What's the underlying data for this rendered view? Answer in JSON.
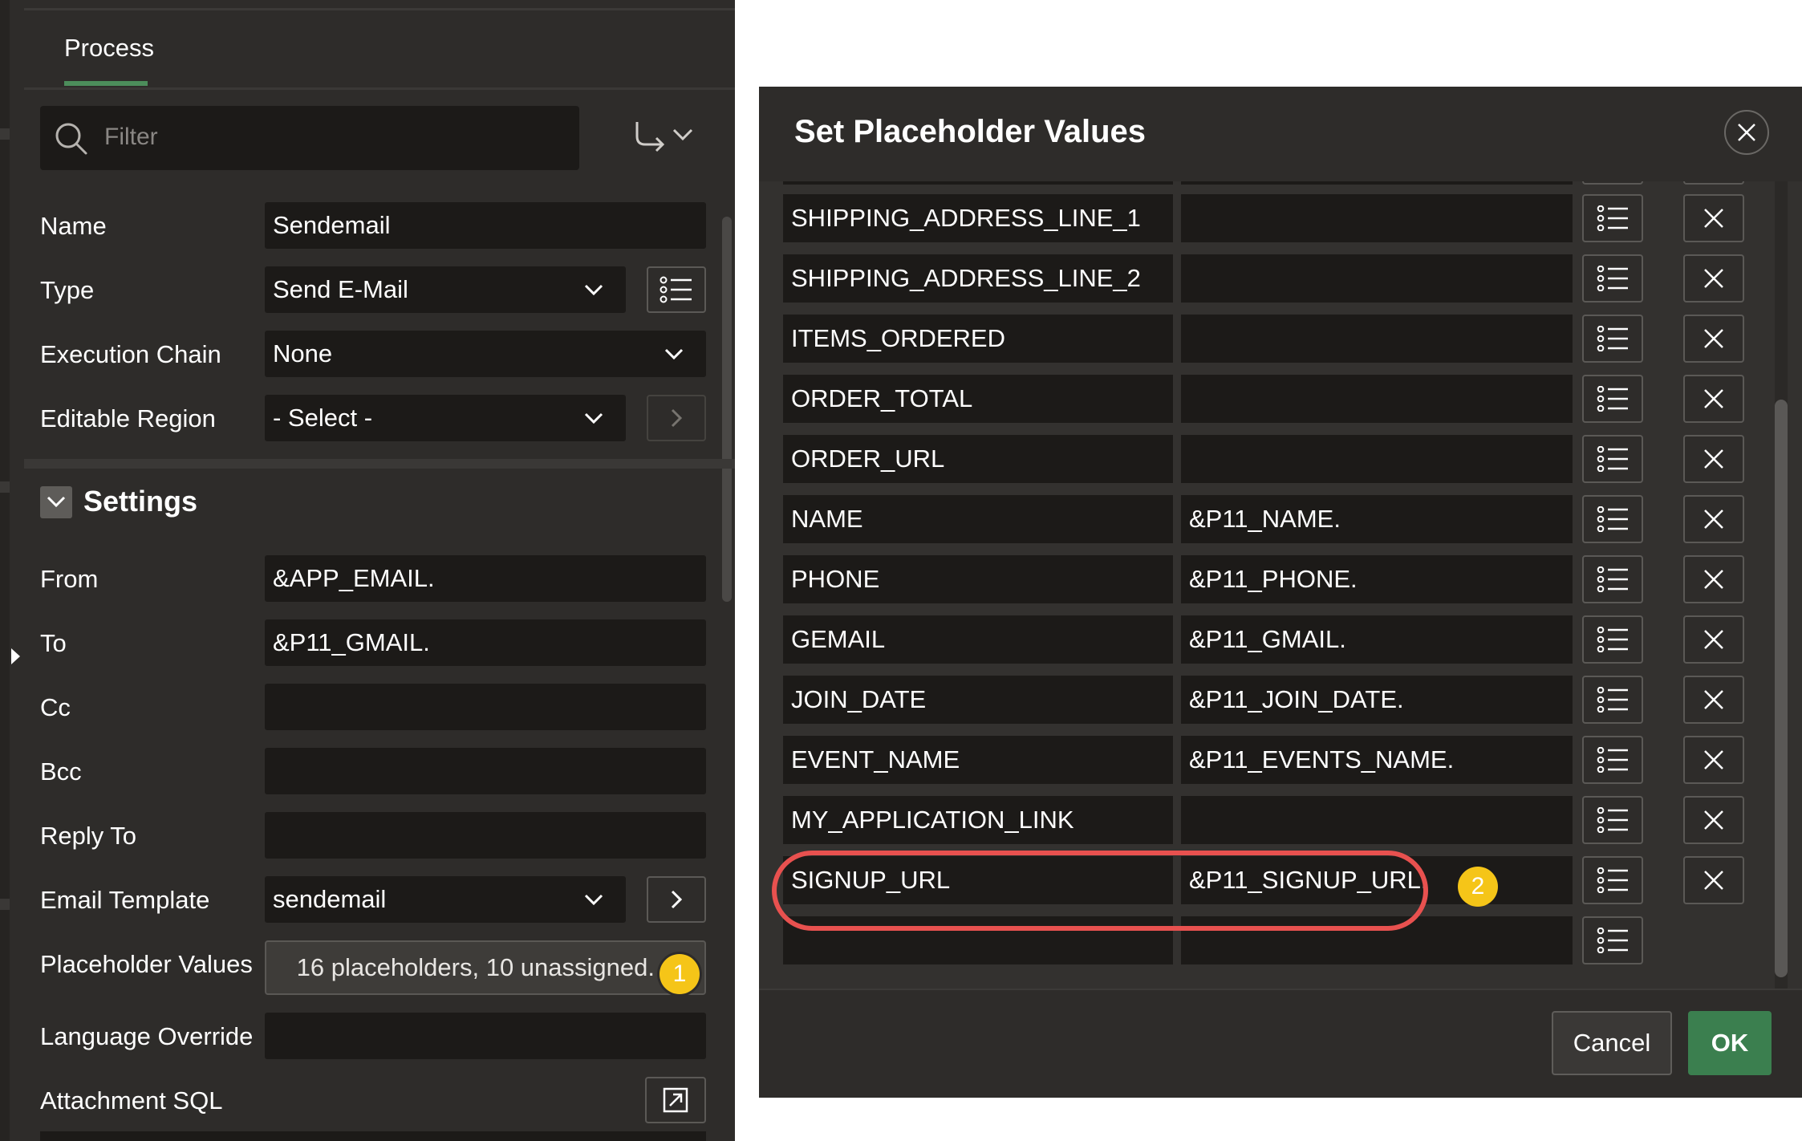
{
  "left_panel": {
    "tab": "Process",
    "filter_placeholder": "Filter",
    "fields": {
      "name": {
        "label": "Name",
        "value": "Sendemail"
      },
      "type": {
        "label": "Type",
        "value": "Send E-Mail"
      },
      "execution_chain": {
        "label": "Execution Chain",
        "value": "None"
      },
      "editable_region": {
        "label": "Editable Region",
        "value": "- Select -"
      }
    },
    "settings": {
      "title": "Settings",
      "from": {
        "label": "From",
        "value": "&APP_EMAIL."
      },
      "to": {
        "label": "To",
        "value": "&P11_GMAIL."
      },
      "cc": {
        "label": "Cc",
        "value": ""
      },
      "bcc": {
        "label": "Bcc",
        "value": ""
      },
      "reply_to": {
        "label": "Reply To",
        "value": ""
      },
      "email_template": {
        "label": "Email Template",
        "value": "sendemail"
      },
      "placeholder_values": {
        "label": "Placeholder Values",
        "value": "16 placeholders, 10 unassigned."
      },
      "language_override": {
        "label": "Language Override",
        "value": ""
      },
      "attachment_sql": {
        "label": "Attachment SQL"
      }
    },
    "badge": "1"
  },
  "dialog": {
    "title": "Set Placeholder Values",
    "rows": [
      {
        "name": "SHIPPING_ADDRESS_LINE_1",
        "value": ""
      },
      {
        "name": "SHIPPING_ADDRESS_LINE_2",
        "value": ""
      },
      {
        "name": "ITEMS_ORDERED",
        "value": ""
      },
      {
        "name": "ORDER_TOTAL",
        "value": ""
      },
      {
        "name": "ORDER_URL",
        "value": ""
      },
      {
        "name": "NAME",
        "value": "&P11_NAME."
      },
      {
        "name": "PHONE",
        "value": "&P11_PHONE."
      },
      {
        "name": "GEMAIL",
        "value": "&P11_GMAIL."
      },
      {
        "name": "JOIN_DATE",
        "value": "&P11_JOIN_DATE."
      },
      {
        "name": "EVENT_NAME",
        "value": "&P11_EVENTS_NAME."
      },
      {
        "name": "MY_APPLICATION_LINK",
        "value": ""
      },
      {
        "name": "SIGNUP_URL",
        "value": "&P11_SIGNUP_URL."
      },
      {
        "name": "",
        "value": ""
      }
    ],
    "badge": "2",
    "cancel_label": "Cancel",
    "ok_label": "OK"
  },
  "colors": {
    "panel_bg": "#2e2c2a",
    "field_bg": "#1c1a18",
    "accent_green": "#3b7f4f",
    "tab_underline": "#4c8d5b",
    "badge_yellow": "#f5c518",
    "highlight_red": "#e8514f"
  },
  "icons": {
    "search": "search-icon",
    "route": "route-arrow-icon",
    "list": "list-icon",
    "close": "close-icon",
    "chevron_down": "chevron-down-icon",
    "chevron_right": "chevron-right-icon",
    "open_external": "open-external-icon"
  }
}
